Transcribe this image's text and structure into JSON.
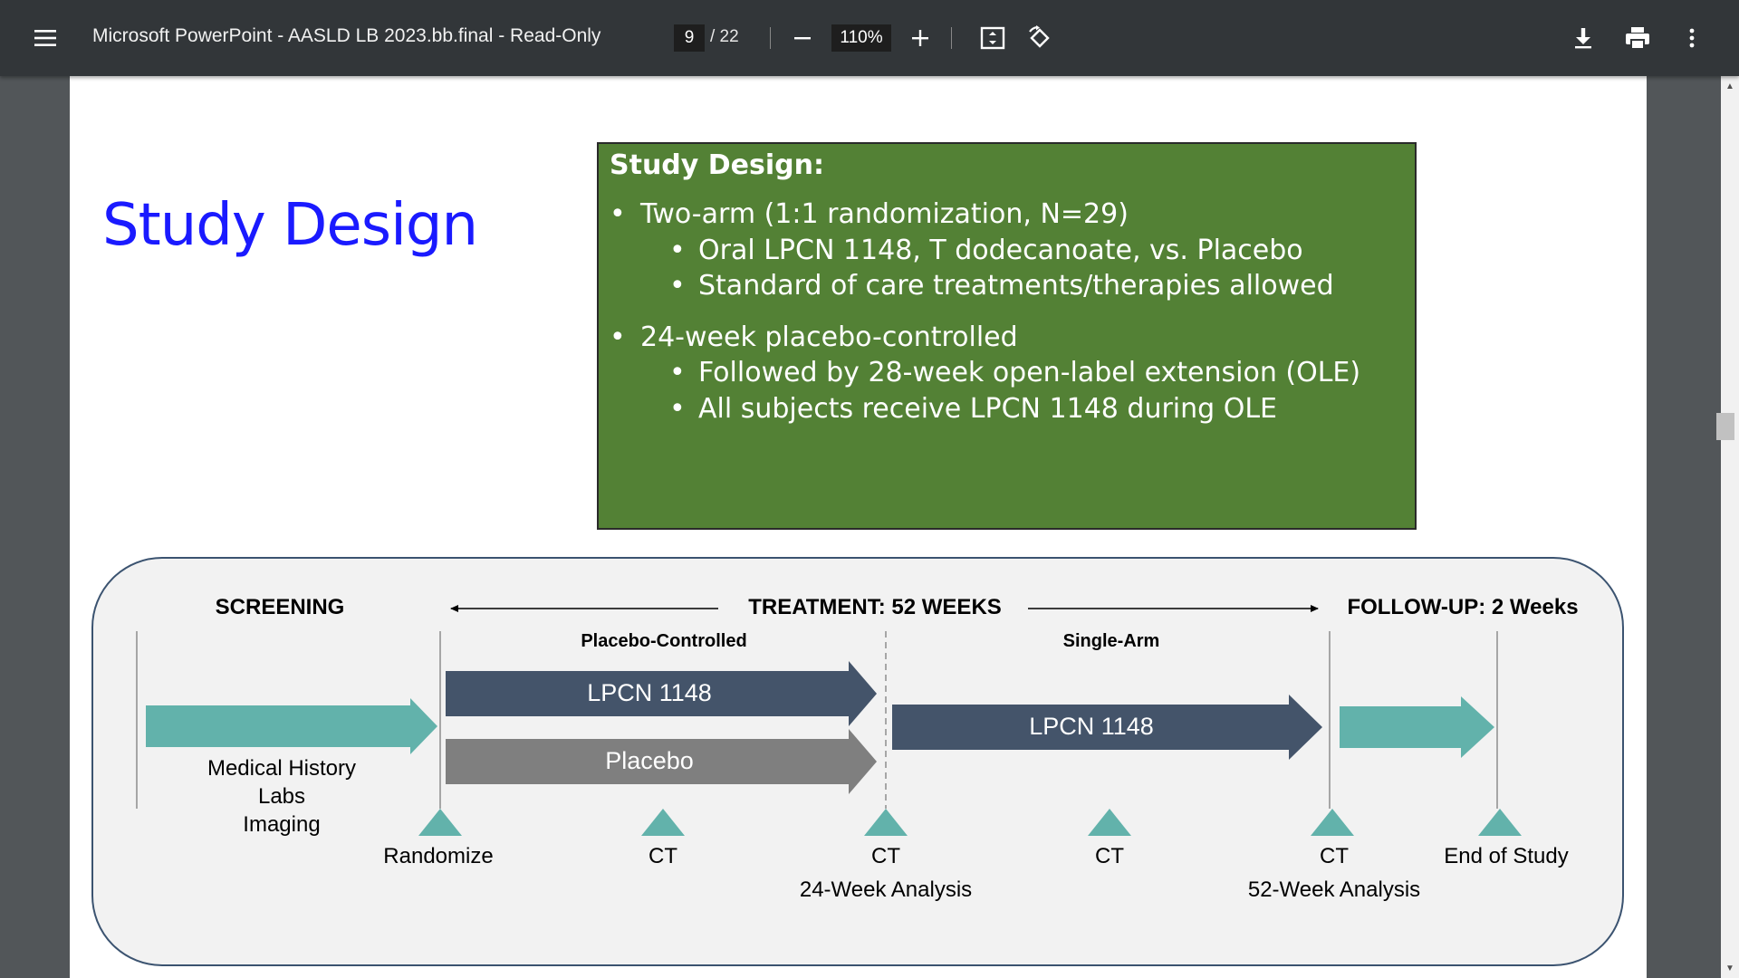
{
  "toolbar": {
    "menu_icon": "hamburger-menu-icon",
    "title": "Microsoft PowerPoint - AASLD LB 2023.bb.final - Read-Only",
    "page_current": "9",
    "page_total": "/ 22",
    "zoom": "110%",
    "icons": [
      "zoom-out-icon",
      "zoom-in-icon",
      "fit-page-icon",
      "rotate-icon",
      "download-icon",
      "print-icon",
      "more-options-icon"
    ]
  },
  "slide": {
    "title": "Study Design",
    "box": {
      "heading": "Study Design:",
      "bullet1": "Two-arm (1:1 randomization, N=29)",
      "bullet1_sub1": "Oral LPCN 1148, T dodecanoate, vs. Placebo",
      "bullet1_sub2": "Standard of care treatments/therapies allowed",
      "bullet2": "24-week placebo-controlled",
      "bullet2_sub1": "Followed by 28-week open-label extension (OLE)",
      "bullet2_sub2": "All subjects receive LPCN 1148 during OLE",
      "bullet_char": "•"
    },
    "timeline": {
      "screening": "SCREENING",
      "treatment": "TREATMENT: 52 WEEKS",
      "followup": "FOLLOW-UP: 2 Weeks",
      "placebo_controlled": "Placebo-Controlled",
      "single_arm": "Single-Arm",
      "arrow_lpcn1": "LPCN 1148",
      "arrow_placebo": "Placebo",
      "arrow_lpcn2": "LPCN 1148",
      "screening_line1": "Medical History",
      "screening_line2": "Labs",
      "screening_line3": "Imaging",
      "m_randomize": "Randomize",
      "m_ct1": "CT",
      "m_ct2": "CT",
      "m_24": "24-Week Analysis",
      "m_ct3": "CT",
      "m_ct4": "CT",
      "m_52": "52-Week Analysis",
      "m_end": "End of Study"
    },
    "colors": {
      "teal": "#62b2ab",
      "navy": "#44546a",
      "gray": "#7f7f7f",
      "green": "#538135",
      "title_blue": "#1a1aff"
    }
  }
}
